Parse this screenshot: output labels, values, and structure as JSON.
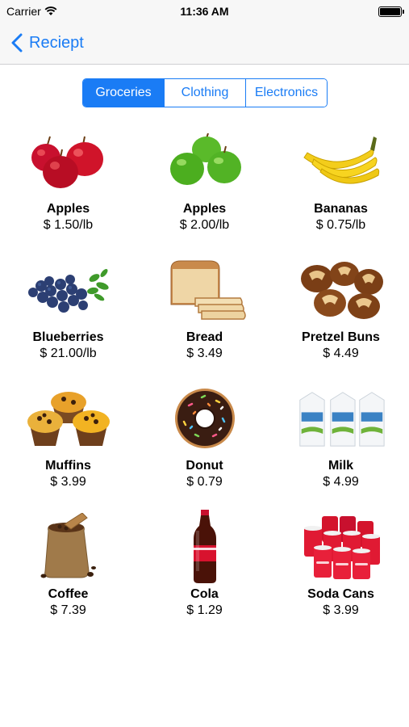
{
  "status_bar": {
    "carrier": "Carrier",
    "time": "11:36 AM"
  },
  "nav": {
    "back_label": "Reciept"
  },
  "segments": [
    {
      "label": "Groceries",
      "selected": true
    },
    {
      "label": "Clothing",
      "selected": false
    },
    {
      "label": "Electronics",
      "selected": false
    }
  ],
  "items": [
    {
      "name": "Apples",
      "price": "$ 1.50/lb",
      "icon": "red-apples-icon"
    },
    {
      "name": "Apples",
      "price": "$ 2.00/lb",
      "icon": "green-apples-icon"
    },
    {
      "name": "Bananas",
      "price": "$ 0.75/lb",
      "icon": "bananas-icon"
    },
    {
      "name": "Blueberries",
      "price": "$ 21.00/lb",
      "icon": "blueberries-icon"
    },
    {
      "name": "Bread",
      "price": "$ 3.49",
      "icon": "bread-icon"
    },
    {
      "name": "Pretzel Buns",
      "price": "$ 4.49",
      "icon": "pretzel-buns-icon"
    },
    {
      "name": "Muffins",
      "price": "$ 3.99",
      "icon": "muffins-icon"
    },
    {
      "name": "Donut",
      "price": "$ 0.79",
      "icon": "donut-icon"
    },
    {
      "name": "Milk",
      "price": "$ 4.99",
      "icon": "milk-icon"
    },
    {
      "name": "Coffee",
      "price": "$ 7.39",
      "icon": "coffee-icon"
    },
    {
      "name": "Cola",
      "price": "$ 1.29",
      "icon": "cola-icon"
    },
    {
      "name": "Soda Cans",
      "price": "$ 3.99",
      "icon": "soda-cans-icon"
    }
  ],
  "colors": {
    "accent": "#1a7cf5",
    "bar_background": "#f7f7f7"
  }
}
